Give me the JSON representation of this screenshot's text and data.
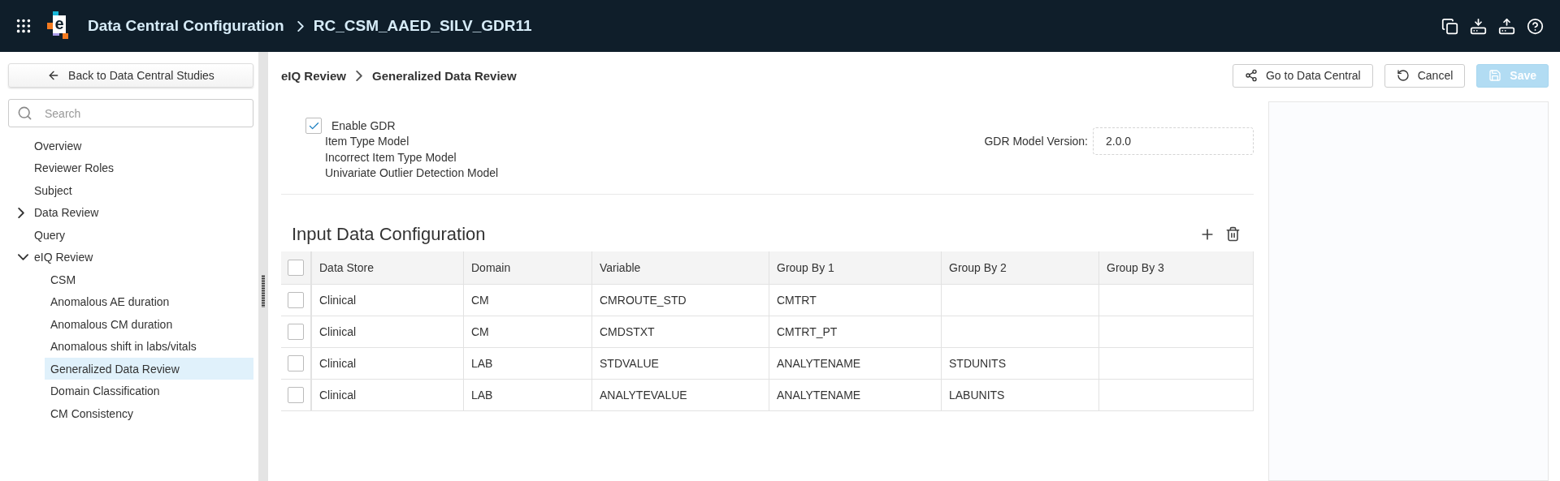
{
  "header": {
    "logo_letter": "e",
    "title": "Data Central Configuration",
    "study": "RC_CSM_AAED_SILV_GDR11"
  },
  "sidebar": {
    "back_button": "Back to Data Central Studies",
    "search": {
      "placeholder": "Search"
    },
    "nav": [
      {
        "label": "Overview",
        "selected": false
      },
      {
        "label": "Reviewer Roles",
        "selected": false
      },
      {
        "label": "Subject",
        "selected": false
      },
      {
        "label": "Data Review",
        "selected": false,
        "expanded": false
      },
      {
        "label": "Query",
        "selected": false
      },
      {
        "label": "eIQ Review",
        "selected": false,
        "expanded": true,
        "children": [
          {
            "label": "CSM",
            "selected": false
          },
          {
            "label": "Anomalous AE duration",
            "selected": false
          },
          {
            "label": "Anomalous CM duration",
            "selected": false
          },
          {
            "label": "Anomalous shift in labs/vitals",
            "selected": false
          },
          {
            "label": "Generalized Data Review",
            "selected": true
          },
          {
            "label": "Domain Classification",
            "selected": false
          },
          {
            "label": "CM Consistency",
            "selected": false
          }
        ]
      }
    ]
  },
  "breadcrumb": [
    "eIQ Review",
    "Generalized Data Review"
  ],
  "actions": [
    {
      "kind": "network",
      "label": "Go to Data Central",
      "disabled": false,
      "primary": false
    },
    {
      "kind": "undo",
      "label": "Cancel",
      "disabled": false,
      "primary": false
    },
    {
      "kind": "save",
      "label": "Save",
      "disabled": true,
      "primary": true
    }
  ],
  "gdr": {
    "enable": {
      "label": "Enable GDR",
      "checked": true
    },
    "models": [
      "Item Type Model",
      "Incorrect Item Type Model",
      "Univariate Outlier Detection Model"
    ],
    "version_label": "GDR Model Version:",
    "version_value": "2.0.0"
  },
  "table": {
    "title": "Input Data Configuration",
    "all_checked": false,
    "columns": [
      "Data Store",
      "Domain",
      "Variable",
      "Group By 1",
      "Group By 2",
      "Group By 3"
    ],
    "rows": [
      {
        "checked": false,
        "cells": [
          "Clinical",
          "CM",
          "CMROUTE_STD",
          "CMTRT",
          "",
          ""
        ]
      },
      {
        "checked": false,
        "cells": [
          "Clinical",
          "CM",
          "CMDSTXT",
          "CMTRT_PT",
          "",
          ""
        ]
      },
      {
        "checked": false,
        "cells": [
          "Clinical",
          "LAB",
          "STDVALUE",
          "ANALYTENAME",
          "STDUNITS",
          ""
        ]
      },
      {
        "checked": false,
        "cells": [
          "Clinical",
          "LAB",
          "ANALYTEVALUE",
          "ANALYTENAME",
          "LABUNITS",
          ""
        ]
      }
    ]
  }
}
